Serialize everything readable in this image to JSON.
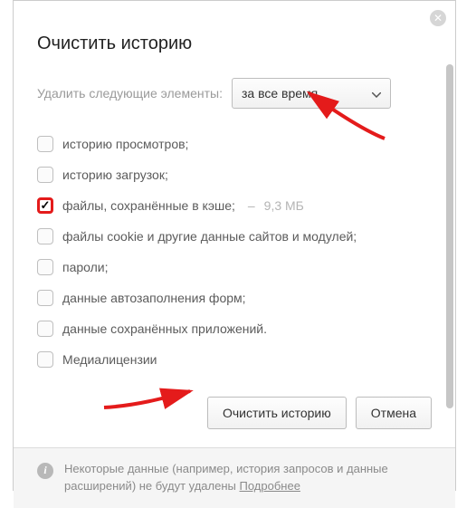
{
  "title": "Очистить историю",
  "range": {
    "label": "Удалить следующие элементы:",
    "selected": "за все время"
  },
  "options": [
    {
      "label": "историю просмотров;",
      "checked": false
    },
    {
      "label": "историю загрузок;",
      "checked": false
    },
    {
      "label": "файлы, сохранённые в кэше;",
      "checked": true,
      "size_sep": "–",
      "size": "9,3 МБ"
    },
    {
      "label": "файлы cookie и другие данные сайтов и модулей;",
      "checked": false
    },
    {
      "label": "пароли;",
      "checked": false
    },
    {
      "label": "данные автозаполнения форм;",
      "checked": false
    },
    {
      "label": "данные сохранённых приложений.",
      "checked": false
    },
    {
      "label": "Медиалицензии",
      "checked": false
    }
  ],
  "buttons": {
    "clear": "Очистить историю",
    "cancel": "Отмена"
  },
  "footer": {
    "text": "Некоторые данные (например, история запросов и данные расширений) не будут удалены ",
    "more": "Подробнее"
  }
}
